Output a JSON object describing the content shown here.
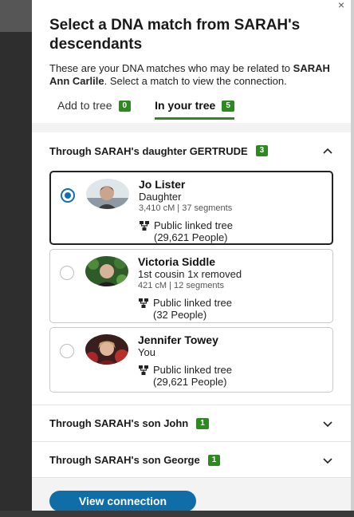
{
  "panel": {
    "close_glyph": "×",
    "title": "Select a DNA match from SARAH's descendants",
    "desc_prefix": "These are your DNA matches who may be related to ",
    "desc_name": "SARAH Ann Carlile",
    "desc_suffix": ". Select a match to view the connection."
  },
  "tabs": [
    {
      "label": "Add to tree",
      "count": "0",
      "active": false
    },
    {
      "label": "In your tree",
      "count": "5",
      "active": true
    }
  ],
  "sections": [
    {
      "label": "Through SARAH's daughter GERTRUDE",
      "count": "3",
      "expanded": true,
      "matches": [
        {
          "name": "Jo Lister",
          "relationship": "Daughter",
          "dna": "3,410 cM | 37 segments",
          "tree_label": "Public linked tree",
          "tree_people": "(29,621 People)",
          "selected": true
        },
        {
          "name": "Victoria Siddle",
          "relationship": "1st cousin 1x removed",
          "dna": "421 cM | 12 segments",
          "tree_label": "Public linked tree",
          "tree_people": "(32 People)",
          "selected": false
        },
        {
          "name": "Jennifer Towey",
          "relationship": "You",
          "dna": "",
          "tree_label": "Public linked tree",
          "tree_people": "(29,621 People)",
          "selected": false
        }
      ]
    },
    {
      "label": "Through SARAH's son John",
      "count": "1",
      "expanded": false
    },
    {
      "label": "Through SARAH's son George",
      "count": "1",
      "expanded": false
    }
  ],
  "footer": {
    "view_label": "View connection"
  },
  "icons": {
    "radio": "radio-icon",
    "tree": "family-tree-icon",
    "expand": "chevron-icon"
  },
  "colors": {
    "accent_green": "#2c8a1e",
    "primary_blue": "#0f6ea8",
    "radio_blue": "#136fa5"
  }
}
